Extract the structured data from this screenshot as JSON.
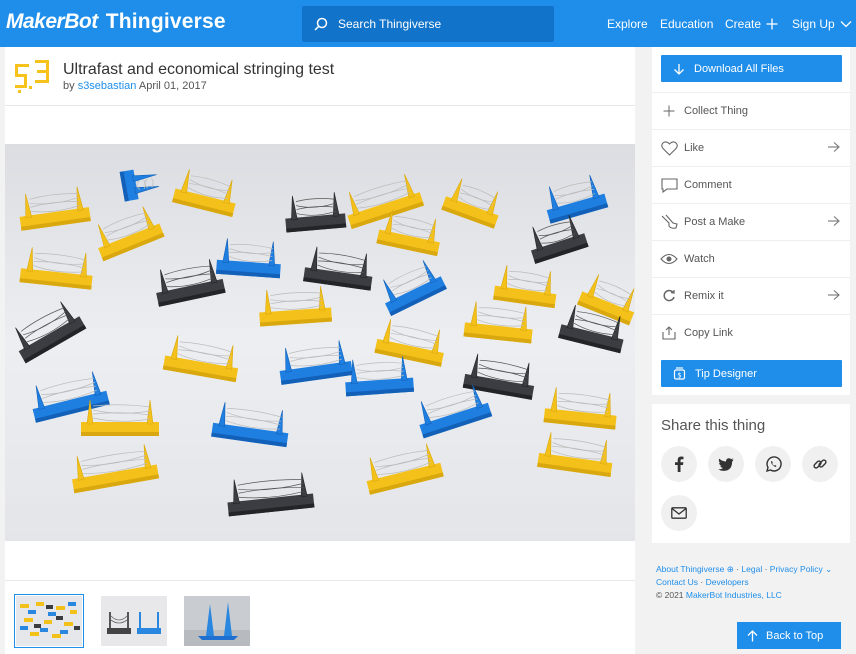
{
  "header": {
    "logo_part1": "MakerBot",
    "logo_part2": "Thingiverse",
    "search_placeholder": "Search Thingiverse",
    "nav": {
      "explore": "Explore",
      "education": "Education",
      "create": "Create",
      "signup": "Sign Up"
    }
  },
  "thing": {
    "title": "Ultrafast and economical stringing test",
    "by": "by",
    "author": "s3sebastian",
    "date": "April 01, 2017"
  },
  "thumbnails": [
    "thumb-1",
    "thumb-2",
    "thumb-3"
  ],
  "sidebar": {
    "download": "Download All Files",
    "actions": {
      "collect": "Collect Thing",
      "like": "Like",
      "comment": "Comment",
      "make": "Post a Make",
      "watch": "Watch",
      "remix": "Remix it",
      "copy": "Copy Link"
    },
    "tip": "Tip Designer"
  },
  "share": {
    "title": "Share this thing"
  },
  "footer": {
    "about": "About Thingiverse",
    "legal": "Legal",
    "privacy": "Privacy Policy",
    "contact": "Contact Us",
    "developers": "Developers",
    "copyright_prefix": "©  2021",
    "company": "MakerBot Industries, LLC"
  },
  "back_to_top": "Back to Top",
  "colors": {
    "brand": "#1e8eea",
    "search_bg": "#1173c9",
    "page_bg": "#f2f2f2"
  }
}
